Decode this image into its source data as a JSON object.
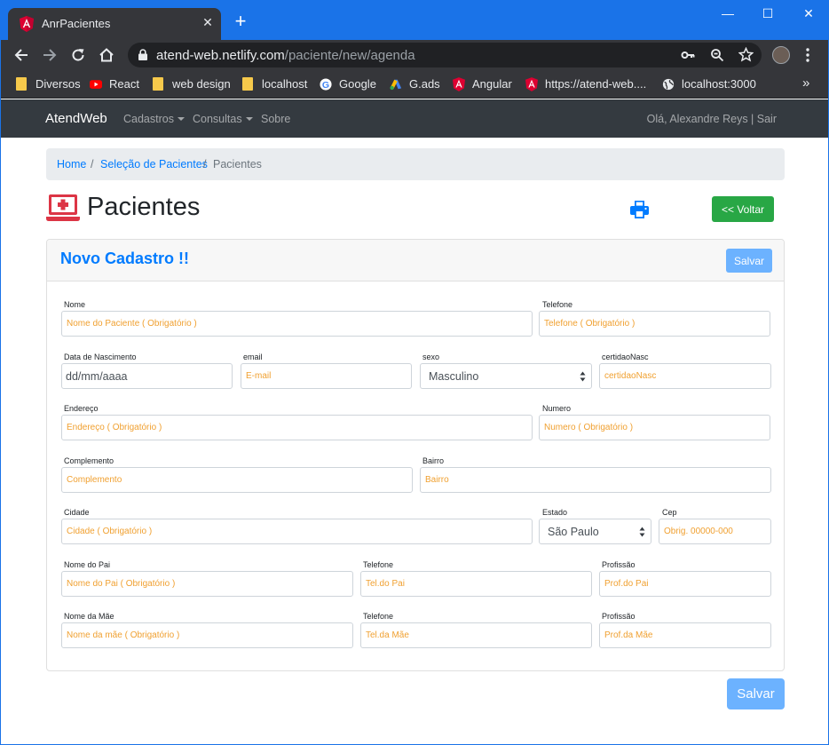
{
  "browser": {
    "tab_title": "AnrPacientes",
    "new_tab_symbol": "+",
    "tab_close_symbol": "✕",
    "url_host": "atend-web.netlify.com",
    "url_path": "/paciente/new/agenda",
    "window_controls": {
      "minimize": "—",
      "maximize": "☐",
      "close": "✕"
    },
    "bookmarks": [
      {
        "label": "Diversos",
        "icon": "folder-icon"
      },
      {
        "label": "React",
        "icon": "youtube-icon"
      },
      {
        "label": "web design",
        "icon": "folder-icon"
      },
      {
        "label": "localhost",
        "icon": "folder-icon"
      },
      {
        "label": "Google",
        "icon": "google-icon"
      },
      {
        "label": "G.ads",
        "icon": "google-ads-icon"
      },
      {
        "label": "Angular",
        "icon": "angular-icon"
      },
      {
        "label": "https://atend-web....",
        "icon": "angular-icon"
      },
      {
        "label": "localhost:3000",
        "icon": "globe-icon"
      }
    ],
    "bookmarks_more": "»"
  },
  "navbar": {
    "brand": "AtendWeb",
    "links": [
      "Cadastros",
      "Consultas",
      "Sobre"
    ],
    "user": "Olá, Alexandre Reys | Sair"
  },
  "breadcrumb": {
    "items": [
      "Home",
      "Seleção de Pacientes",
      "Pacientes"
    ],
    "separator": "/"
  },
  "page": {
    "title": "Pacientes",
    "back_button": "<< Voltar"
  },
  "card": {
    "title": "Novo Cadastro !!",
    "save_label": "Salvar"
  },
  "form": {
    "nome": {
      "label": "Nome",
      "placeholder": "Nome do Paciente ( Obrigatório )"
    },
    "telefone": {
      "label": "Telefone",
      "placeholder": "Telefone ( Obrigatório )"
    },
    "nascimento": {
      "label": "Data de Nascimento",
      "value": "dd/mm/aaaa"
    },
    "email": {
      "label": "email",
      "placeholder": "E-mail"
    },
    "sexo": {
      "label": "sexo",
      "value": "Masculino"
    },
    "certidao": {
      "label": "certidaoNasc",
      "placeholder": "certidaoNasc"
    },
    "endereco": {
      "label": "Endereço",
      "placeholder": "Endereço ( Obrigatório )"
    },
    "numero": {
      "label": "Numero",
      "placeholder": "Numero ( Obrigatório )"
    },
    "complemento": {
      "label": "Complemento",
      "placeholder": "Complemento"
    },
    "bairro": {
      "label": "Bairro",
      "placeholder": "Bairro"
    },
    "cidade": {
      "label": "Cidade",
      "placeholder": "Cidade ( Obrigatório )"
    },
    "estado": {
      "label": "Estado",
      "value": "São Paulo"
    },
    "cep": {
      "label": "Cep",
      "placeholder": "Obrig. 00000-000"
    },
    "nome_pai": {
      "label": "Nome do Pai",
      "placeholder": "Nome do Pai ( Obrigatório )"
    },
    "tel_pai": {
      "label": "Telefone",
      "placeholder": "Tel.do Pai"
    },
    "prof_pai": {
      "label": "Profissão",
      "placeholder": "Prof.do Pai"
    },
    "nome_mae": {
      "label": "Nome da Mãe",
      "placeholder": "Nome da mãe ( Obrigatório )"
    },
    "tel_mae": {
      "label": "Telefone",
      "placeholder": "Tel.da Mãe"
    },
    "prof_mae": {
      "label": "Profissão",
      "placeholder": "Prof.da Mãe"
    }
  },
  "footer_save_label": "Salvar",
  "colors": {
    "chrome_accent": "#1a73e8",
    "navbar_bg": "#343a40",
    "link": "#007bff",
    "success": "#28a745",
    "primary_disabled": "#6cb2ff",
    "placeholder": "#f0a030",
    "brand_red": "#dc3545"
  }
}
